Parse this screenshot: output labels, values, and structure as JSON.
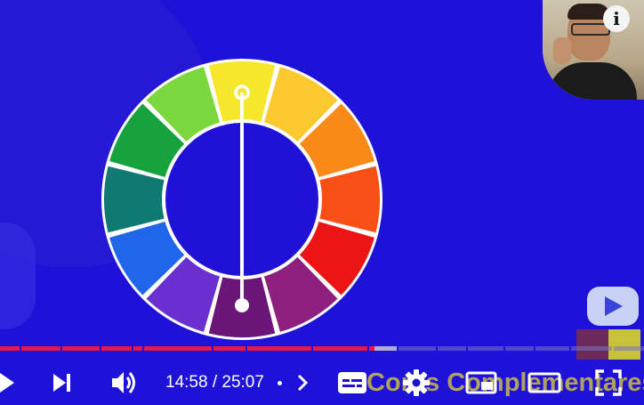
{
  "video": {
    "background_color": "#1f12d8",
    "color_wheel": {
      "segments": [
        {
          "name": "yellow",
          "color": "#f5e82c"
        },
        {
          "name": "yellow-orange",
          "color": "#fbc82e"
        },
        {
          "name": "orange",
          "color": "#f98a18"
        },
        {
          "name": "red-orange",
          "color": "#f84f16"
        },
        {
          "name": "red",
          "color": "#ec1414"
        },
        {
          "name": "red-violet",
          "color": "#8e1f7e"
        },
        {
          "name": "violet",
          "color": "#6a1577"
        },
        {
          "name": "blue-violet",
          "color": "#6a2fcf"
        },
        {
          "name": "blue",
          "color": "#1f66ea"
        },
        {
          "name": "blue-green",
          "color": "#0e7a71"
        },
        {
          "name": "green",
          "color": "#16a33d"
        },
        {
          "name": "yellow-green",
          "color": "#7ad83c"
        }
      ],
      "ring_color": "#ffffff",
      "inner_color": "#2011d6",
      "pointer_color": "#ffffff"
    },
    "overlay_text": "Cores Complementares",
    "overlay_text_color": "#d9cb3a",
    "brand_swatches": [
      "#6b2a5a",
      "#c7c23a"
    ]
  },
  "info_button": {
    "label": "i",
    "icon": "info-icon"
  },
  "player": {
    "progress": {
      "played_fraction": 0.581,
      "buffered_fraction": 0.56,
      "played_color": "#e8164b",
      "buffer_color": "#c9c6dd",
      "track_color": "#7a72c8"
    },
    "current_time": "14:58",
    "separator": " / ",
    "duration": "25:07",
    "time_display": "14:58 / 25:07",
    "controls": {
      "play": "play-icon",
      "next": "next-icon",
      "volume": "volume-icon",
      "chapter_chevron": "chevron-right-icon",
      "subtitles": "subtitles-icon",
      "settings": "gear-icon",
      "miniplayer": "miniplayer-icon",
      "theater": "theater-mode-icon",
      "fullscreen": "fullscreen-icon"
    }
  }
}
